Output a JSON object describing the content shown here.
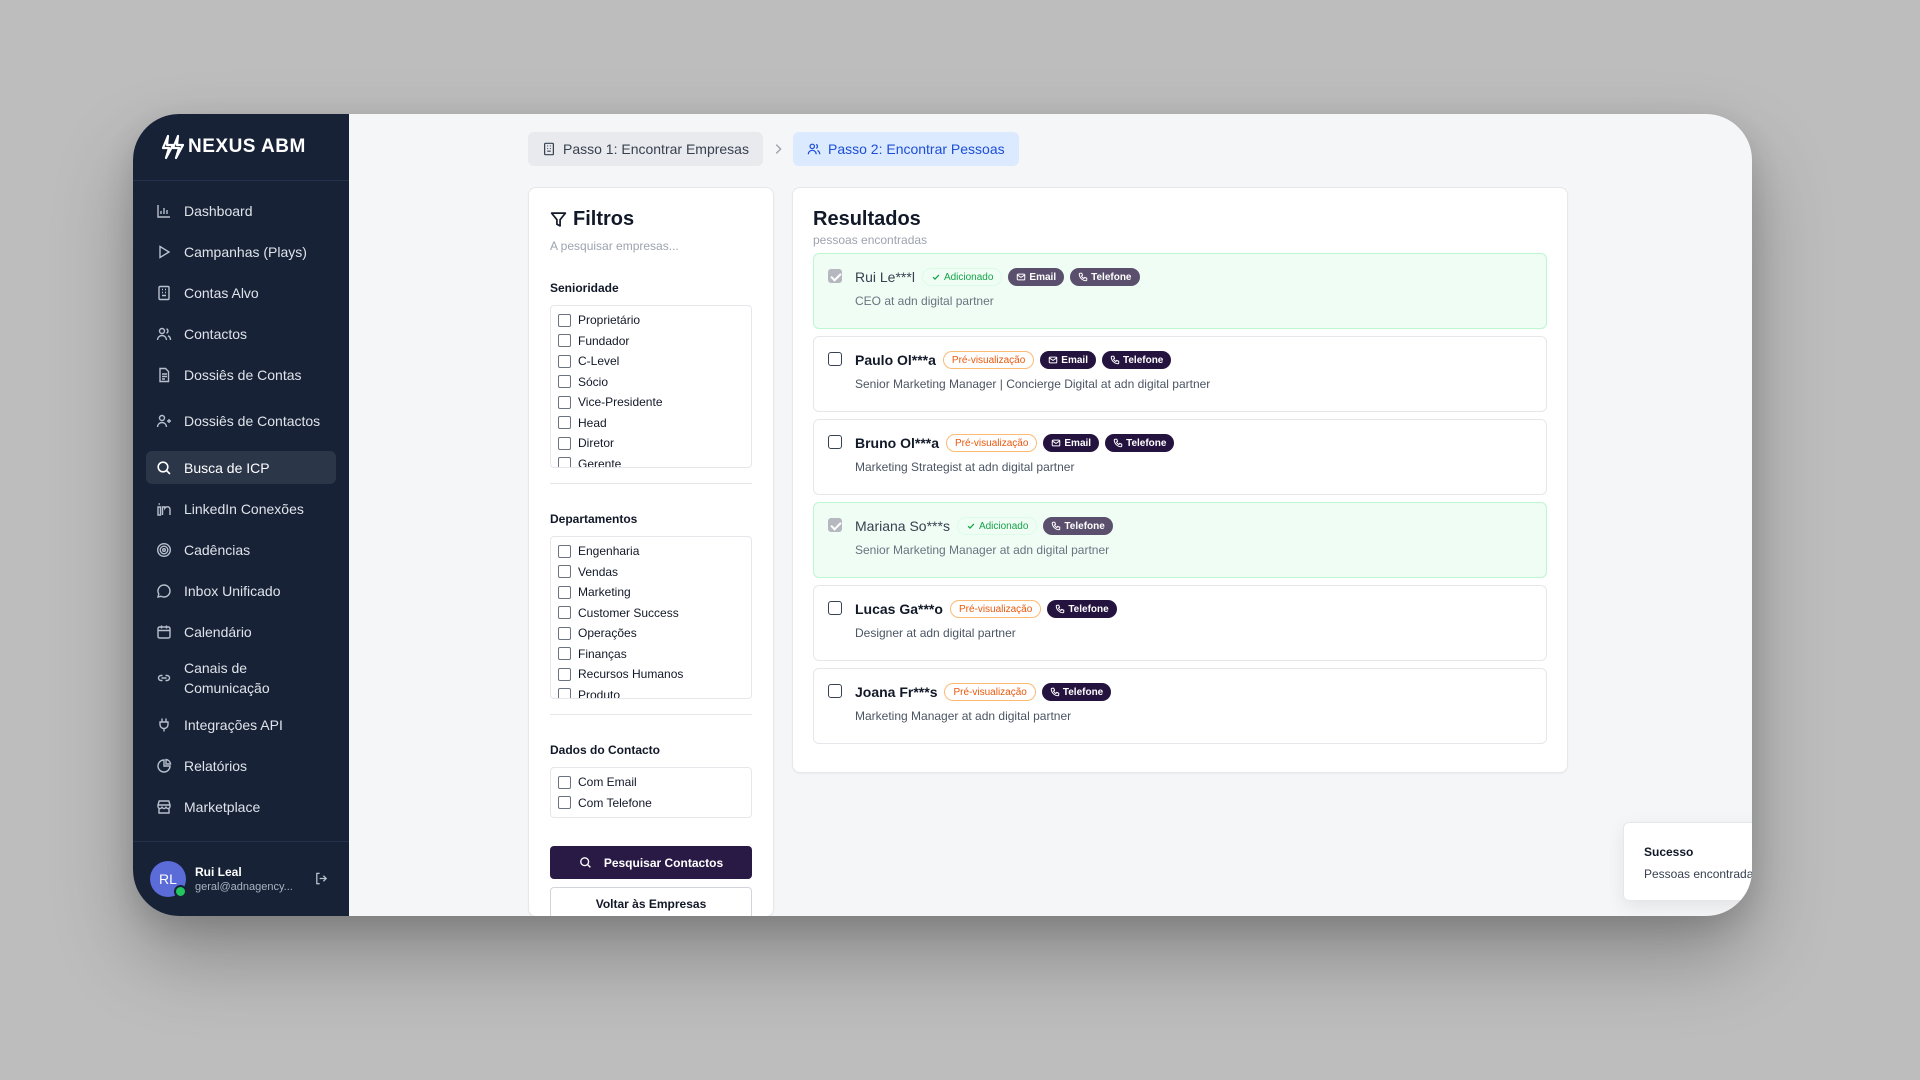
{
  "brand": {
    "name": "NEXUS ABM",
    "logo_icon": "bolt-icon"
  },
  "sidebar": {
    "items": [
      {
        "label": "Dashboard",
        "icon": "bar-chart-icon",
        "active": false
      },
      {
        "label": "Campanhas (Plays)",
        "icon": "play-icon",
        "active": false
      },
      {
        "label": "Contas Alvo",
        "icon": "building-icon",
        "active": false
      },
      {
        "label": "Contactos",
        "icon": "users-icon",
        "active": false
      },
      {
        "label": "Dossiês de Contas",
        "icon": "file-icon",
        "active": false
      },
      {
        "label": "Dossiês de Contactos",
        "icon": "user-plus-icon",
        "active": false
      },
      {
        "label": "Busca de ICP",
        "icon": "search-icon",
        "active": true
      },
      {
        "label": "LinkedIn Conexões",
        "icon": "linkedin-icon",
        "active": false
      },
      {
        "label": "Cadências",
        "icon": "target-icon",
        "active": false
      },
      {
        "label": "Inbox Unificado",
        "icon": "message-icon",
        "active": false
      },
      {
        "label": "Calendário",
        "icon": "calendar-icon",
        "active": false
      },
      {
        "label": "Canais de Comunicação",
        "icon": "link-icon",
        "active": false
      },
      {
        "label": "Integrações API",
        "icon": "plug-icon",
        "active": false
      },
      {
        "label": "Relatórios",
        "icon": "pie-chart-icon",
        "active": false
      },
      {
        "label": "Marketplace",
        "icon": "store-icon",
        "active": false
      }
    ],
    "user": {
      "initials": "RL",
      "name": "Rui Leal",
      "email": "geral@adnagency...",
      "logout_icon": "logout-icon"
    }
  },
  "steps": [
    {
      "label": "Passo 1: Encontrar Empresas",
      "icon": "building-icon",
      "active": false
    },
    {
      "label": "Passo 2: Encontrar Pessoas",
      "icon": "users-icon",
      "active": true
    }
  ],
  "filters": {
    "title": "Filtros",
    "subtitle": "A pesquisar empresas...",
    "seniority": {
      "title": "Senioridade",
      "options": [
        "Proprietário",
        "Fundador",
        "C-Level",
        "Sócio",
        "Vice-Presidente",
        "Head",
        "Diretor",
        "Gerente"
      ]
    },
    "departments": {
      "title": "Departamentos",
      "options": [
        "Engenharia",
        "Vendas",
        "Marketing",
        "Customer Success",
        "Operações",
        "Finanças",
        "Recursos Humanos",
        "Produto"
      ]
    },
    "contact": {
      "title": "Dados do Contacto",
      "options": [
        "Com Email",
        "Com Telefone"
      ]
    },
    "search_button": "Pesquisar Contactos",
    "back_button": "Voltar às Empresas"
  },
  "results": {
    "title": "Resultados",
    "subtitle": "pessoas encontradas",
    "items": [
      {
        "name": "Rui Le***l",
        "status": "added",
        "status_label": "Adicionado",
        "badges": [
          "Email",
          "Telefone"
        ],
        "role": "CEO at adn digital partner"
      },
      {
        "name": "Paulo Ol***a",
        "status": "preview",
        "status_label": "Pré-visualização",
        "badges": [
          "Email",
          "Telefone"
        ],
        "role": "Senior Marketing Manager | Concierge Digital at adn digital partner"
      },
      {
        "name": "Bruno Ol***a",
        "status": "preview",
        "status_label": "Pré-visualização",
        "badges": [
          "Email",
          "Telefone"
        ],
        "role": "Marketing Strategist at adn digital partner"
      },
      {
        "name": "Mariana So***s",
        "status": "added",
        "status_label": "Adicionado",
        "badges": [
          "Telefone"
        ],
        "role": "Senior Marketing Manager at adn digital partner"
      },
      {
        "name": "Lucas Ga***o",
        "status": "preview",
        "status_label": "Pré-visualização",
        "badges": [
          "Telefone"
        ],
        "role": "Designer at adn digital partner"
      },
      {
        "name": "Joana Fr***s",
        "status": "preview",
        "status_label": "Pré-visualização",
        "badges": [
          "Telefone"
        ],
        "role": "Marketing Manager at adn digital partner"
      }
    ]
  },
  "toast": {
    "title": "Sucesso",
    "message": "Pessoas encontradas"
  },
  "colors": {
    "sidebar_bg": "#172236",
    "primary": "#281a45",
    "step_active_bg": "#dbeafe",
    "step_active_text": "#1d4ed8",
    "added_bg": "#f0fdf4",
    "preview_text": "#ea580c"
  }
}
